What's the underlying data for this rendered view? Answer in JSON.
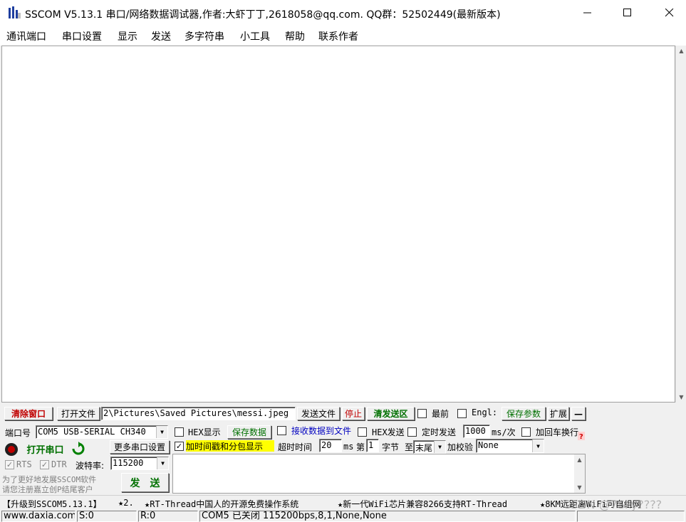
{
  "window": {
    "title": "SSCOM V5.13.1 串口/网络数据调试器,作者:大虾丁丁,2618058@qq.com. QQ群：52502449(最新版本)",
    "minimize": "—",
    "maximize": "☐",
    "close": "✕"
  },
  "menu": [
    "通讯端口",
    "串口设置",
    "显示",
    "发送",
    "多字符串",
    "小工具",
    "帮助",
    "联系作者"
  ],
  "toolbar": {
    "clear_window": "清除窗口",
    "open_file": "打开文件",
    "file_path": "2\\Pictures\\Saved Pictures\\messi.jpeg",
    "send_file": "发送文件",
    "stop": "停止",
    "clear_send": "清发送区",
    "topmost": "最前",
    "english": "Engl:",
    "save_params": "保存参数",
    "expand": "扩展",
    "collapse": "—"
  },
  "port": {
    "port_label": "端口号",
    "port_value": "COM5 USB-SERIAL CH340",
    "open_port": "打开串口",
    "more_settings": "更多串口设置",
    "rts": "RTS",
    "dtr": "DTR",
    "baud_label": "波特率:",
    "baud_value": "115200"
  },
  "options": {
    "hex_display": "HEX显示",
    "save_data": "保存数据",
    "recv_to_file": "接收数据到文件",
    "hex_send": "HEX发送",
    "timed_send": "定时发送",
    "interval": "1000",
    "interval_unit": "ms/次",
    "add_crlf": "加回车换行",
    "timestamp": "加时间戳和分包显示",
    "timeout_label": "超时时间",
    "timeout_value": "20",
    "timeout_unit": "ms",
    "nth_label": "第",
    "nth_value": "1",
    "byte_label": "字节",
    "to_label": "至",
    "end_value": "末尾",
    "checksum_label": "加校验",
    "checksum_value": "None"
  },
  "promo": {
    "line1": "为了更好地发展SSCOM软件",
    "line2": "请您注册嘉立创P结尾客户"
  },
  "send_button": "发　送",
  "ticker": [
    "【升级到SSCOM5.13.1】",
    "★2.",
    "★RT-Thread中国人的开源免费操作系统",
    "★新一代WiFi芯片兼容8266支持RT-Thread",
    "★8KM远距离WiFi可自组网"
  ],
  "status": {
    "website": "www.daxia.com",
    "sent": "S:0",
    "received": "R:0",
    "port_state": "COM5 已关闭  115200bps,8,1,None,None"
  },
  "watermark": "CSDN @7Sky????"
}
